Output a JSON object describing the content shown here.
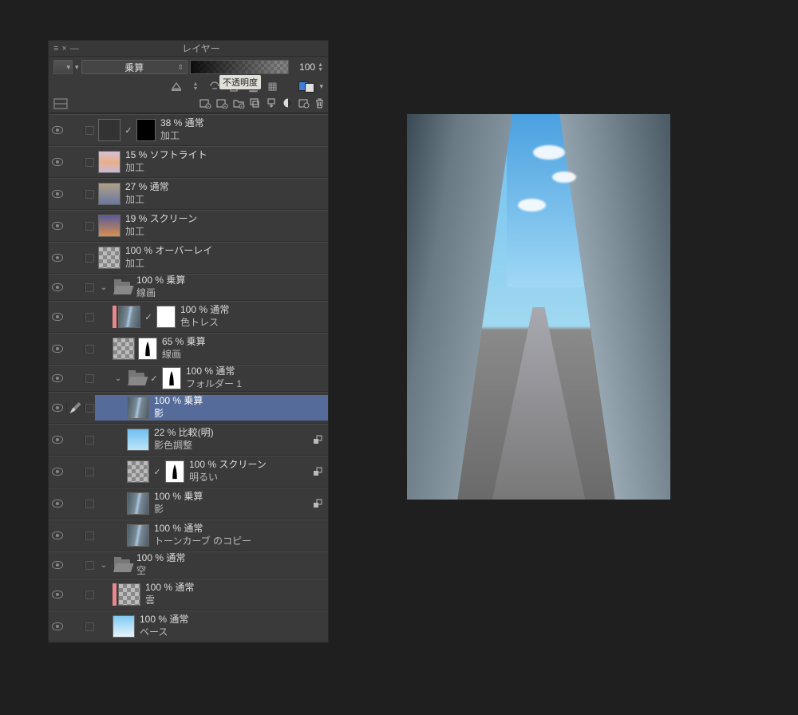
{
  "panel": {
    "title": "レイヤー",
    "blend_mode": "乗算",
    "opacity_value": "100",
    "tooltip": "不透明度"
  },
  "layers": [
    {
      "opmode": "38 % 通常",
      "name": "加工",
      "indent": 0,
      "vis": true,
      "hasMask": true,
      "maskKind": "curve-black",
      "checked": true,
      "thumb": "curve",
      "sel": false
    },
    {
      "opmode": "15 % ソフトライト",
      "name": "加工",
      "indent": 0,
      "vis": true,
      "hasMask": false,
      "thumb": "grad1",
      "sel": false
    },
    {
      "opmode": "27 % 通常",
      "name": "加工",
      "indent": 0,
      "vis": true,
      "hasMask": false,
      "thumb": "grad2",
      "sel": false
    },
    {
      "opmode": "19 % スクリーン",
      "name": "加工",
      "indent": 0,
      "vis": true,
      "hasMask": false,
      "thumb": "grad3",
      "sel": false
    },
    {
      "opmode": "100 % オーバーレイ",
      "name": "加工",
      "indent": 0,
      "vis": true,
      "hasMask": false,
      "thumb": "checker",
      "sel": false
    },
    {
      "opmode": "100 % 乗算",
      "name": "線画",
      "indent": 0,
      "vis": true,
      "folder": true,
      "open": true,
      "sel": false
    },
    {
      "opmode": "100 % 通常",
      "name": "色トレス",
      "indent": 1,
      "vis": true,
      "hasMask": true,
      "maskKind": "white",
      "checked": true,
      "thumb": "art1",
      "colorTag": true,
      "sel": false
    },
    {
      "opmode": "65 % 乗算",
      "name": "線画",
      "indent": 1,
      "vis": true,
      "hasMask": true,
      "maskKind": "white-fig",
      "thumb": "checker",
      "sel": false
    },
    {
      "opmode": "100 % 通常",
      "name": "フォルダー 1",
      "indent": 1,
      "vis": true,
      "folder": true,
      "open": true,
      "hasMask": true,
      "maskKind": "white-fig",
      "checked": true,
      "sel": false
    },
    {
      "opmode": "100 % 乗算",
      "name": "影",
      "indent": 2,
      "vis": true,
      "thumb": "art2",
      "editing": true,
      "sel": true
    },
    {
      "opmode": "22 % 比較(明)",
      "name": "影色調整",
      "indent": 2,
      "vis": true,
      "thumb": "art-sky",
      "badge": true,
      "sel": false
    },
    {
      "opmode": "100 % スクリーン",
      "name": "明るい",
      "indent": 2,
      "vis": true,
      "hasMask": true,
      "maskKind": "white-fig",
      "checked": true,
      "thumb": "checker",
      "badge": true,
      "sel": false
    },
    {
      "opmode": "100 % 乗算",
      "name": "影",
      "indent": 2,
      "vis": true,
      "thumb": "art-dim",
      "badge": true,
      "sel": false
    },
    {
      "opmode": "100 % 通常",
      "name": "トーンカーブ のコピー",
      "indent": 2,
      "vis": true,
      "thumb": "art3",
      "sel": false
    },
    {
      "opmode": "100 % 通常",
      "name": "空",
      "indent": 0,
      "vis": true,
      "folder": true,
      "open": true,
      "sel": false
    },
    {
      "opmode": "100 % 通常",
      "name": "雲",
      "indent": 1,
      "vis": true,
      "thumb": "checker",
      "colorTag": true,
      "sel": false
    },
    {
      "opmode": "100 % 通常",
      "name": "ベース",
      "indent": 1,
      "vis": true,
      "thumb": "skygrad",
      "sel": false
    }
  ]
}
